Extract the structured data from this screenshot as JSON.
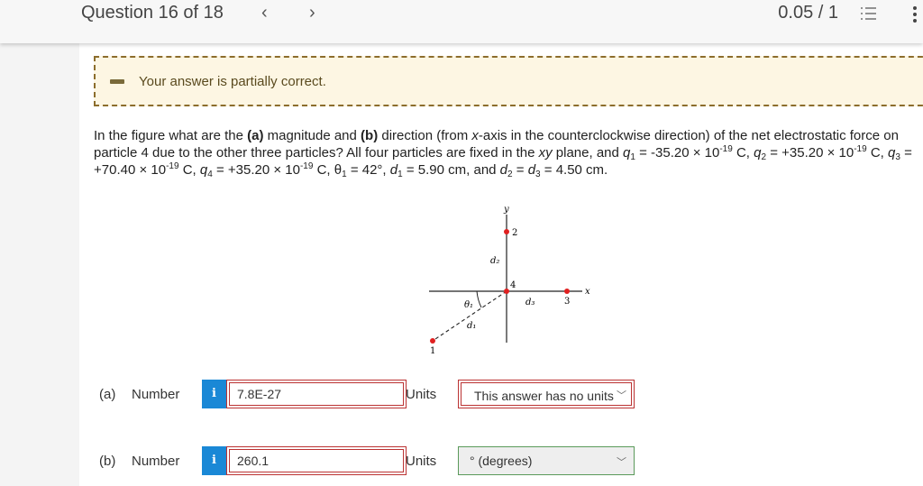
{
  "header": {
    "title": "Question 16 of 18",
    "prev": "‹",
    "next": "›",
    "score": "0.05 / 1",
    "icons": [
      "list-icon",
      "more-vertical-icon"
    ]
  },
  "banner": {
    "message": "Your answer is partially correct.",
    "icon": "minus-icon",
    "color": "#8c6d2c"
  },
  "question": {
    "segments": [
      {
        "t": "In the figure what are the "
      },
      {
        "b": "(a)"
      },
      {
        "t": " magnitude and "
      },
      {
        "b": "(b)"
      },
      {
        "t": " direction (from "
      },
      {
        "i": "x"
      },
      {
        "t": "-axis in the counterclockwise direction) of the net electrostatic force on particle 4 due to the other three particles? All four particles are fixed in the "
      },
      {
        "i": "xy"
      },
      {
        "t": " plane, and "
      },
      {
        "i": "q"
      },
      {
        "sub": "1"
      },
      {
        "t": " = -35.20 × 10"
      },
      {
        "sup": "-19"
      },
      {
        "t": " C, "
      },
      {
        "i": "q"
      },
      {
        "sub": "2"
      },
      {
        "t": " = +35.20 × 10"
      },
      {
        "sup": "-19"
      },
      {
        "t": " C, "
      },
      {
        "i": "q"
      },
      {
        "sub": "3"
      },
      {
        "t": " = +70.40 × 10"
      },
      {
        "sup": "-19"
      },
      {
        "t": " C, "
      },
      {
        "i": "q"
      },
      {
        "sub": "4"
      },
      {
        "t": " = +35.20 × 10"
      },
      {
        "sup": "-19"
      },
      {
        "t": " C, θ"
      },
      {
        "sub": "1"
      },
      {
        "t": " = 42°, "
      },
      {
        "i": "d"
      },
      {
        "sub": "1"
      },
      {
        "t": " = 5.90 cm, and "
      },
      {
        "i": "d"
      },
      {
        "sub": "2"
      },
      {
        "t": " = "
      },
      {
        "i": "d"
      },
      {
        "sub": "3"
      },
      {
        "t": " = 4.50 cm."
      }
    ]
  },
  "figure": {
    "labels": {
      "y": "y",
      "x": "x",
      "p1": "1",
      "p2": "2",
      "p3": "3",
      "p4": "4",
      "d1": "d₁",
      "d2": "d₂",
      "d3": "d₃",
      "theta": "θ₁"
    },
    "point_color": "#e02020"
  },
  "answers": [
    {
      "part": "(a)",
      "label": "Number",
      "value": "7.8E-27",
      "units_label": "Units",
      "units": "This answer has no units",
      "units_state": "incorrect"
    },
    {
      "part": "(b)",
      "label": "Number",
      "value": "260.1",
      "units_label": "Units",
      "units": "° (degrees)",
      "units_state": "correct"
    }
  ],
  "info_icon": "i"
}
